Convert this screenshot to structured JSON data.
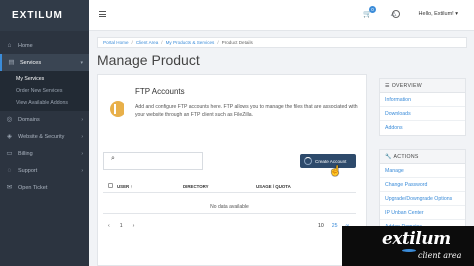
{
  "brand": "EXTILUM",
  "nav": [
    {
      "icon": "home-icon",
      "label": "Home"
    },
    {
      "icon": "services-icon",
      "label": "Services",
      "active": true
    },
    {
      "icon": "domains-icon",
      "label": "Domains"
    },
    {
      "icon": "security-icon",
      "label": "Website & Security"
    },
    {
      "icon": "billing-icon",
      "label": "Billing"
    },
    {
      "icon": "support-icon",
      "label": "Support"
    },
    {
      "icon": "ticket-icon",
      "label": "Open Ticket"
    }
  ],
  "subnav": [
    "My Services",
    "Order New Services",
    "View Available Addons"
  ],
  "topbar": {
    "cart_badge": "0",
    "user": "Hello, Extilum!"
  },
  "breadcrumb": [
    "Portal Home",
    "Client Area",
    "My Products & Services",
    "Product Details"
  ],
  "page_title": "Manage Product",
  "ftp": {
    "title": "FTP Accounts",
    "description": "Add and configure FTP accounts here. FTP allows you to manage the files that are associated with your website through an FTP client such as FileZilla."
  },
  "create_button": "Create Account",
  "table": {
    "headers": [
      "USER",
      "DIRECTORY",
      "USAGE / QUOTA"
    ],
    "empty": "No data available"
  },
  "pager": {
    "prev": "‹",
    "page": "1",
    "next": "›"
  },
  "per_page": [
    "10",
    "25",
    "∞"
  ],
  "overview": {
    "title": "OVERVIEW",
    "links": [
      "Information",
      "Downloads",
      "Addons"
    ]
  },
  "actions": {
    "title": "ACTIONS",
    "links": [
      "Manage",
      "Change Password",
      "Upgrade/Downgrade Options",
      "IP Unban Center",
      "Addon Domains"
    ]
  },
  "watermark": {
    "title": "extilum",
    "subtitle": "client area"
  }
}
